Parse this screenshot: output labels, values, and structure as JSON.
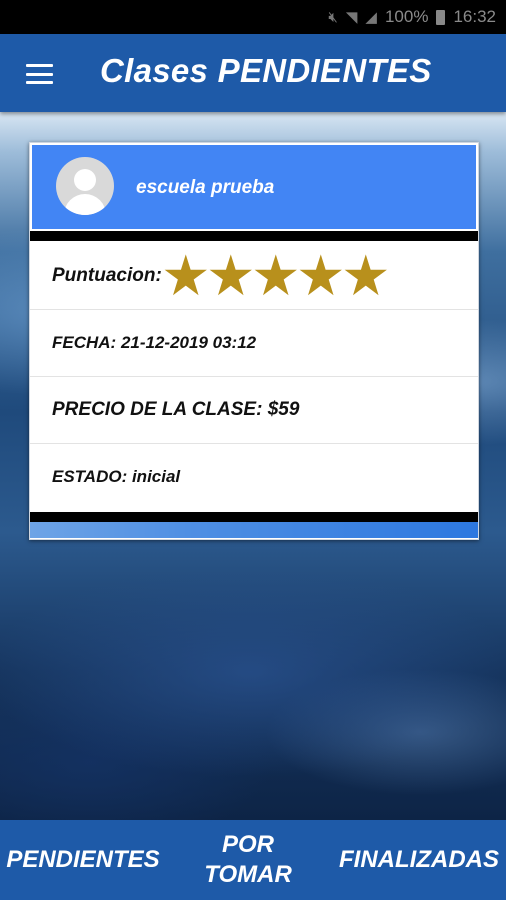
{
  "status_bar": {
    "battery": "100%",
    "time": "16:32",
    "icons": [
      "mute-icon",
      "wifi-icon",
      "signal-icon",
      "battery-icon"
    ]
  },
  "app_bar": {
    "title": "Clases PENDIENTES",
    "menu_icon": "hamburger-menu-icon"
  },
  "card": {
    "school_name": "escuela prueba",
    "avatar_icon": "user-avatar-icon",
    "rating_label": "Puntuacion:",
    "rating_value": 5,
    "rating_max": 5,
    "fecha": "FECHA: 21-12-2019 03:12",
    "precio": "PRECIO DE LA CLASE: $59",
    "estado": "ESTADO: inicial"
  },
  "bottom_nav": {
    "tab_pendientes": "PENDIENTES",
    "tab_por_tomar_line1": "POR",
    "tab_por_tomar_line2": "TOMAR",
    "tab_finalizadas": "FINALIZADAS"
  },
  "colors": {
    "app_bar": "#1e5aa8",
    "card_header": "#4285f4",
    "star": "#b8901c"
  }
}
